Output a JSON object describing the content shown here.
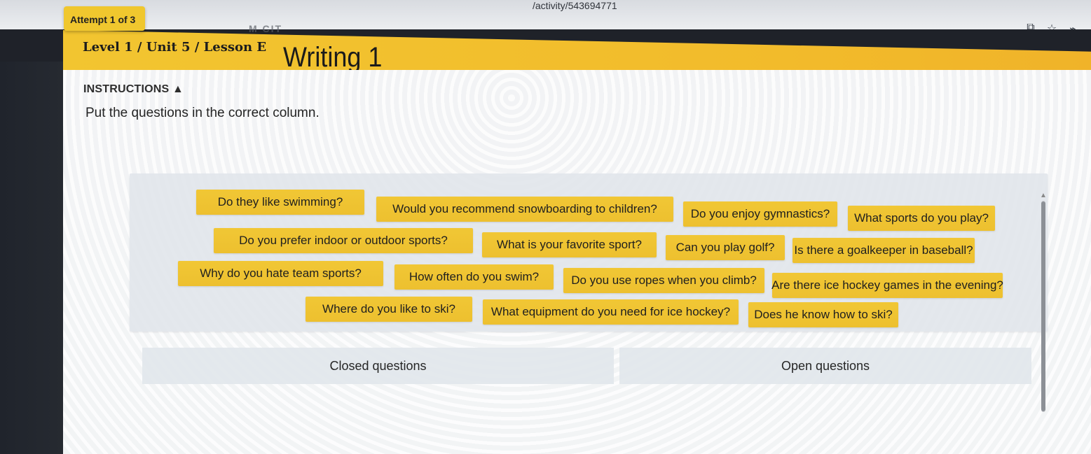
{
  "browser": {
    "url_fragment": "/activity/543694771",
    "icons": [
      "translate-icon",
      "star-icon",
      "extension-icon"
    ]
  },
  "header": {
    "attempt": "Attempt 1 of 3",
    "lesson": "Level 1 / Unit 5 / Lesson E",
    "title": "Writing 1",
    "logo_text": "M CIT"
  },
  "instructions": {
    "heading": "INSTRUCTIONS ▲",
    "text": "Put the questions in the correct column."
  },
  "questions": [
    "Do they like swimming?",
    "Would you recommend snowboarding to children?",
    "Do you enjoy gymnastics?",
    "What sports do you play?",
    "Do you prefer indoor or outdoor sports?",
    "What is your favorite sport?",
    "Can you play golf?",
    "Is there a goalkeeper in baseball?",
    "Why do you hate team sports?",
    "How often do you swim?",
    "Do you use ropes when you climb?",
    "Are there ice hockey games in the evening?",
    "Where do you like to ski?",
    "What equipment do you need for ice hockey?",
    "Does he know how to ski?"
  ],
  "columns": {
    "closed": "Closed questions",
    "open": "Open questions"
  },
  "colors": {
    "accent": "#f1c735",
    "dark": "#1f2229",
    "panel": "#e1e5eb"
  }
}
